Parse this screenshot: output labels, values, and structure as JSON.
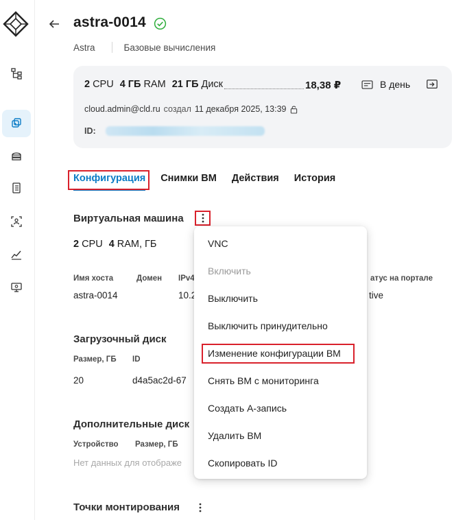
{
  "header": {
    "title": "astra-0014",
    "breadcrumb": [
      "Astra",
      "Базовые вычисления"
    ]
  },
  "summary": {
    "cpu_value": "2",
    "cpu_unit": "CPU",
    "ram_value": "4 ГБ",
    "ram_unit": "RAM",
    "disk_value": "21 ГБ",
    "disk_unit": "Диск",
    "price": "18,38 ₽",
    "period": "В день",
    "owner": "cloud.admin@cld.ru",
    "created_label": "создал",
    "created_at": "11 декабря 2025, 13:39",
    "id_label": "ID:"
  },
  "tabs": [
    {
      "label": "Конфигурация",
      "active": true
    },
    {
      "label": "Снимки ВМ",
      "active": false
    },
    {
      "label": "Действия",
      "active": false
    },
    {
      "label": "История",
      "active": false
    }
  ],
  "vm_section": {
    "title": "Виртуальная машина",
    "cpu_value": "2",
    "cpu_unit": "CPU",
    "ram_value": "4",
    "ram_unit": "RAM, ГБ",
    "columns": [
      "Имя хоста",
      "Домен",
      "IPv4",
      "атус на портале"
    ],
    "row": [
      "astra-0014",
      "10.2",
      "tive"
    ]
  },
  "boot_disk": {
    "title": "Загрузочный диск",
    "columns": [
      "Размер, ГБ",
      "ID"
    ],
    "row": [
      "20",
      "d4a5ac2d-67"
    ]
  },
  "extra_disks": {
    "title": "Дополнительные диск",
    "columns": [
      "Устройство",
      "Размер, ГБ"
    ],
    "empty_text": "Нет данных для отображе"
  },
  "mount_points": {
    "title": "Точки монтирования"
  },
  "menu": {
    "items": [
      {
        "label": "VNC",
        "disabled": false
      },
      {
        "label": "Включить",
        "disabled": true
      },
      {
        "label": "Выключить",
        "disabled": false
      },
      {
        "label": "Выключить принудительно",
        "disabled": false
      },
      {
        "label": "Изменение конфигурации ВМ",
        "disabled": false
      },
      {
        "label": "Снять ВМ с мониторинга",
        "disabled": false
      },
      {
        "label": "Создать А-запись",
        "disabled": false
      },
      {
        "label": "Удалить ВМ",
        "disabled": false
      },
      {
        "label": "Скопировать ID",
        "disabled": false
      }
    ]
  },
  "colors": {
    "accent": "#0c7cc6",
    "highlight": "#d9202b",
    "status_ok": "#2fae3c",
    "card_bg": "#f3f4f6"
  }
}
